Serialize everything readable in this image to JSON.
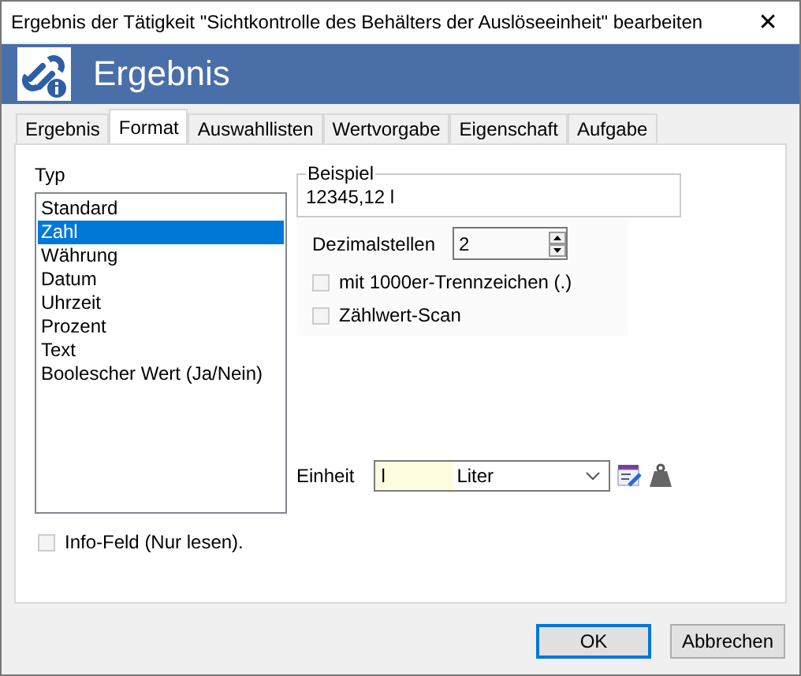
{
  "window": {
    "title": "Ergebnis der Tätigkeit \"Sichtkontrolle des Behälters der Auslöseeinheit\" bearbeiten",
    "close": "✕"
  },
  "banner": {
    "title": "Ergebnis"
  },
  "tabs": [
    {
      "label": "Ergebnis",
      "selected": false
    },
    {
      "label": "Format",
      "selected": true
    },
    {
      "label": "Auswahllisten",
      "selected": false
    },
    {
      "label": "Wertvorgabe",
      "selected": false
    },
    {
      "label": "Eigenschaft",
      "selected": false
    },
    {
      "label": "Aufgabe",
      "selected": false
    }
  ],
  "typ": {
    "label": "Typ",
    "items": [
      {
        "label": "Standard",
        "selected": false
      },
      {
        "label": "Zahl",
        "selected": true
      },
      {
        "label": "Währung",
        "selected": false
      },
      {
        "label": "Datum",
        "selected": false
      },
      {
        "label": "Uhrzeit",
        "selected": false
      },
      {
        "label": "Prozent",
        "selected": false
      },
      {
        "label": "Text",
        "selected": false
      },
      {
        "label": "Boolescher Wert (Ja/Nein)",
        "selected": false
      }
    ]
  },
  "beispiel": {
    "legend": "Beispiel",
    "value": "12345,12 l"
  },
  "dezimalstellen": {
    "label": "Dezimalstellen",
    "value": "2"
  },
  "options": [
    {
      "label": "mit 1000er-Trennzeichen (.)",
      "checked": false,
      "disabled": true
    },
    {
      "label": "Zählwert-Scan",
      "checked": false,
      "disabled": true
    }
  ],
  "einheit": {
    "label": "Einheit",
    "code": "l",
    "unit": "Liter"
  },
  "info_feld": {
    "label": "Info-Feld (Nur lesen).",
    "checked": false,
    "disabled": true
  },
  "buttons": [
    {
      "label": "OK",
      "default": true
    },
    {
      "label": "Abbrechen",
      "default": false
    }
  ]
}
